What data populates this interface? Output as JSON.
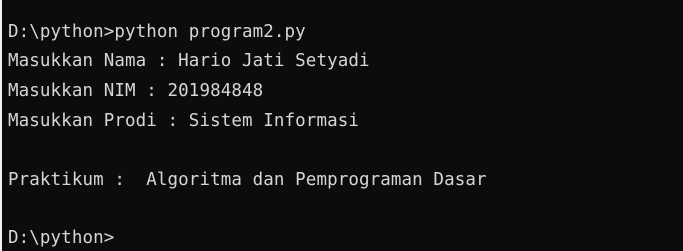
{
  "terminal": {
    "lines": [
      "D:\\python>python program2.py",
      "Masukkan Nama : Hario Jati Setyadi",
      "Masukkan NIM : 201984848",
      "Masukkan Prodi : Sistem Informasi",
      "Praktikum :  Algoritma dan Pemprograman Dasar",
      "D:\\python>"
    ]
  },
  "colors": {
    "background": "#0c0c0c",
    "text": "#d6d6d6",
    "edge": "#f2f2f2"
  }
}
